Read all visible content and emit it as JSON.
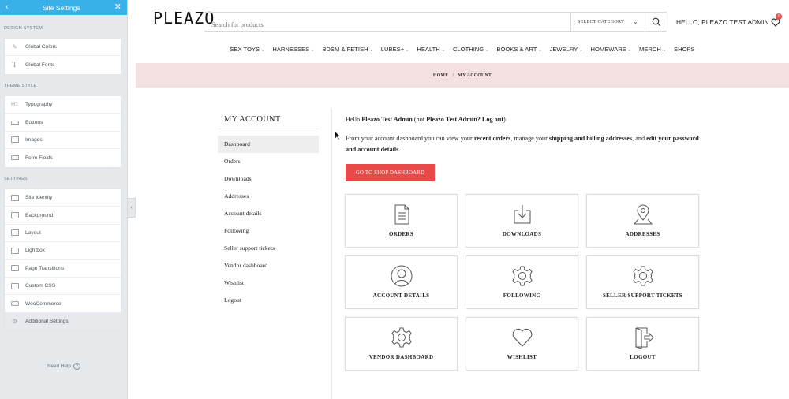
{
  "panel": {
    "title": "Site Settings",
    "back_icon": "chevron-left-icon",
    "close_icon": "close-icon",
    "sections": [
      {
        "title": "DESIGN SYSTEM",
        "items": [
          {
            "label": "Global Colors",
            "icon": "brush-icon"
          },
          {
            "label": "Global Fonts",
            "icon": "font-icon"
          }
        ]
      },
      {
        "title": "THEME STYLE",
        "items": [
          {
            "label": "Typography",
            "icon": "heading-icon"
          },
          {
            "label": "Buttons",
            "icon": "button-icon"
          },
          {
            "label": "Images",
            "icon": "image-icon"
          },
          {
            "label": "Form Fields",
            "icon": "form-icon"
          }
        ]
      },
      {
        "title": "SETTINGS",
        "items": [
          {
            "label": "Site Identity",
            "icon": "identity-icon"
          },
          {
            "label": "Background",
            "icon": "background-icon"
          },
          {
            "label": "Layout",
            "icon": "layout-icon"
          },
          {
            "label": "Lightbox",
            "icon": "lightbox-icon"
          },
          {
            "label": "Page Transitions",
            "icon": "transitions-icon"
          },
          {
            "label": "Custom CSS",
            "icon": "css-icon"
          },
          {
            "label": "WooCommerce",
            "icon": "woocommerce-icon"
          },
          {
            "label": "Additional Settings",
            "icon": "settings-icon"
          }
        ]
      }
    ],
    "need_help": "Need Help",
    "help_glyph": "?",
    "collapse_glyph": "‹"
  },
  "site": {
    "logo": "PLEAZO",
    "search_placeholder": "Search for products",
    "category_label": "SELECT CATEGORY",
    "greeting": "HELLO, PLEAZO TEST ADMIN",
    "wishlist_count": "0",
    "nav": [
      "SEX TOYS",
      "HARNESSES",
      "BDSM & FETISH",
      "LUBES+",
      "HEALTH",
      "CLOTHING",
      "BOOKS & ART",
      "JEWELRY",
      "HOMEWARE",
      "MERCH",
      "SHOPS"
    ],
    "breadcrumb": {
      "home": "HOME",
      "sep": "/",
      "current": "MY ACCOUNT"
    },
    "account": {
      "title": "MY ACCOUNT",
      "menu": [
        "Dashboard",
        "Orders",
        "Downloads",
        "Addresses",
        "Account details",
        "Following",
        "Seller support tickets",
        "Vendor dashboard",
        "Wishlist",
        "Logout"
      ],
      "active": "Dashboard"
    },
    "hello": {
      "prefix": "Hello ",
      "name": "Pleazo Test Admin",
      "mid": " (not ",
      "name2": "Pleazo Test Admin",
      "q": "? ",
      "logout": "Log out",
      "end": ")"
    },
    "intro": {
      "t1": "From your account dashboard you can view your ",
      "b1": "recent orders",
      "t2": ", manage your ",
      "b2": "shipping and billing addresses",
      "t3": ", and ",
      "b3": "edit your password and account details",
      "t4": "."
    },
    "shop_button": "GO TO SHOP DASHBOARD",
    "tiles": [
      {
        "label": "ORDERS",
        "icon": "orders-icon"
      },
      {
        "label": "DOWNLOADS",
        "icon": "download-icon"
      },
      {
        "label": "ADDRESSES",
        "icon": "map-pin-icon"
      },
      {
        "label": "ACCOUNT DETAILS",
        "icon": "user-icon"
      },
      {
        "label": "FOLLOWING",
        "icon": "gear-icon"
      },
      {
        "label": "SELLER SUPPORT TICKETS",
        "icon": "gear-icon"
      },
      {
        "label": "VENDOR DASHBOARD",
        "icon": "gear-icon"
      },
      {
        "label": "WISHLIST",
        "icon": "heart-icon"
      },
      {
        "label": "LOGOUT",
        "icon": "logout-icon"
      }
    ]
  },
  "colors": {
    "panel_header": "#39b0e8",
    "accent_red": "#e84a4a",
    "breadcrumb_bg": "#f4e0e0"
  }
}
